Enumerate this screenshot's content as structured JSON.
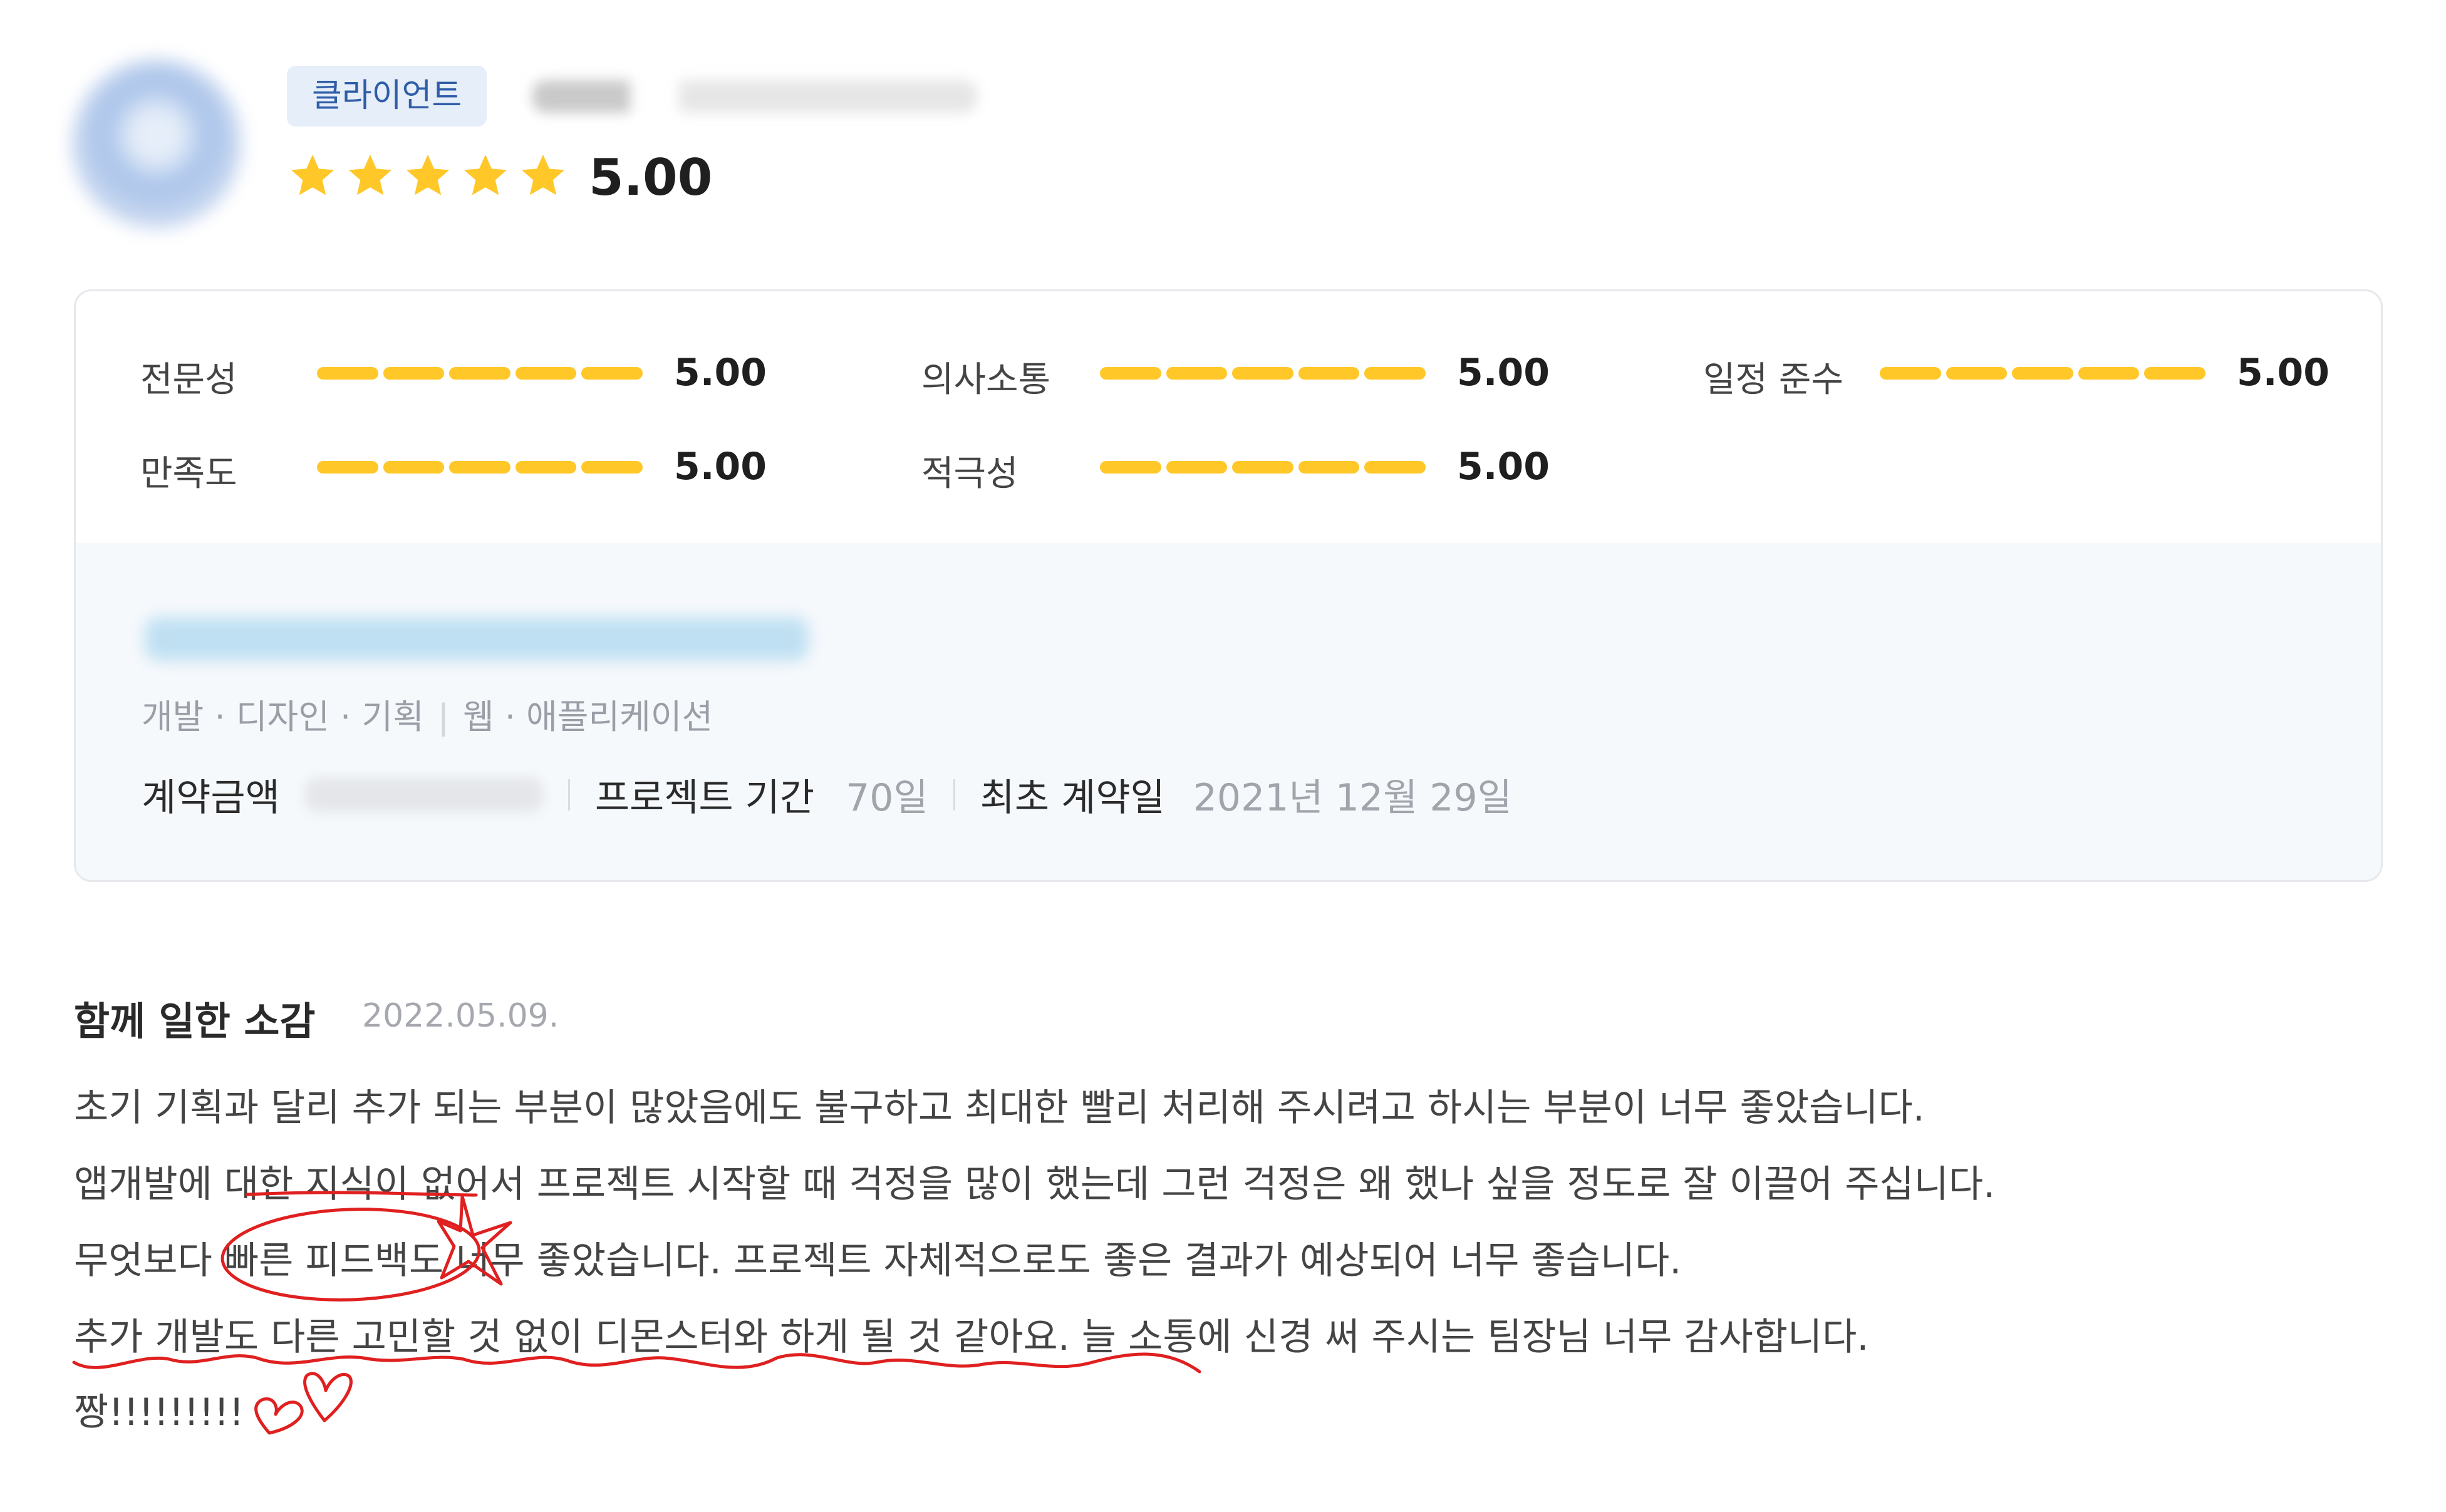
{
  "profile": {
    "badge": "클라이언트",
    "rating": "5.00",
    "stars": 5,
    "star_color": "#FFC828"
  },
  "metrics": [
    {
      "label": "전문성",
      "value": "5.00"
    },
    {
      "label": "의사소통",
      "value": "5.00"
    },
    {
      "label": "일정 준수",
      "value": "5.00"
    },
    {
      "label": "만족도",
      "value": "5.00"
    },
    {
      "label": "적극성",
      "value": "5.00"
    }
  ],
  "project": {
    "categories": [
      "개발 · 디자인 · 기획",
      "웹 · 애플리케이션"
    ],
    "amount_label": "계약금액",
    "period_label": "프로젝트 기간",
    "period_value": "70일",
    "date_label": "최초 계약일",
    "date_value": "2021년 12월 29일"
  },
  "review": {
    "title": "함께 일한 소감",
    "date": "2022.05.09.",
    "lines": [
      "초기 기획과 달리 추가 되는 부분이 많았음에도 불구하고 최대한 빨리 처리해 주시려고 하시는 부분이 너무 좋았습니다.",
      "앱개발에 대한 지식이 없어서 프로젝트 시작할 때 걱정을 많이 했는데 그런 걱정은 왜 했나 싶을 정도로 잘 이끌어 주십니다.",
      "무엇보다 빠른 피드백도 너무 좋았습니다. 프로젝트 자체적으로도 좋은 결과가 예상되어 너무 좋습니다.",
      "추가 개발도 다른 고민할 것 없이 디몬스터와 하게 될 것 같아요. 늘 소통에 신경 써 주시는 팀장님 너무 감사합니다.",
      "짱!!!!!!!!!"
    ]
  },
  "colors": {
    "accent": "#FFC828",
    "badge_bg": "#E6EEF9",
    "badge_text": "#2F5DA8",
    "annotation": "#E02020"
  }
}
